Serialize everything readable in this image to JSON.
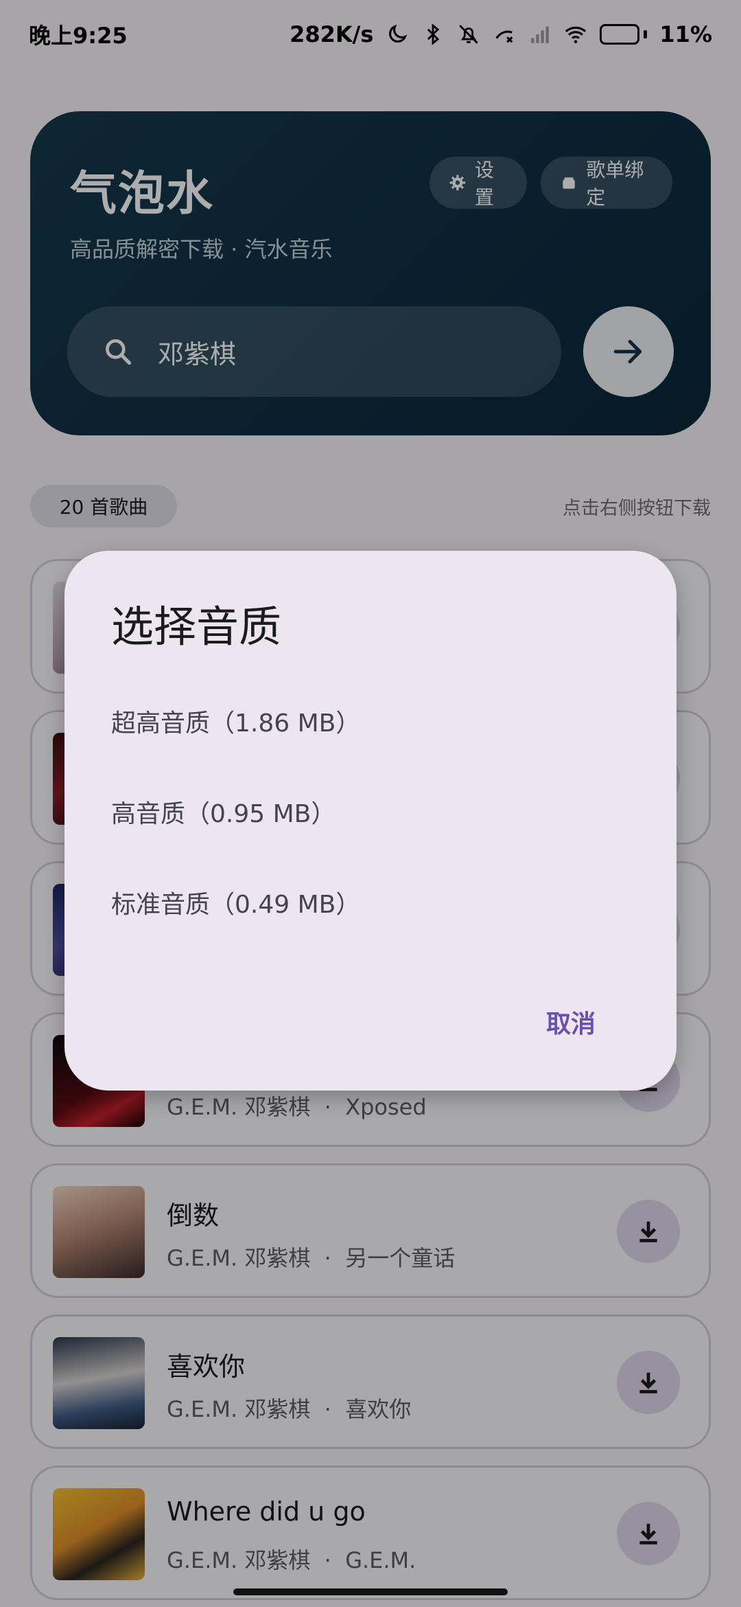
{
  "status_bar": {
    "time": "晚上9:25",
    "network_speed": "282K/s",
    "battery": "11%",
    "icons": [
      "moon-icon",
      "bluetooth-icon",
      "bell-off-icon",
      "phone-icon",
      "signal-icon",
      "wifi-icon",
      "battery-icon"
    ]
  },
  "header": {
    "title": "气泡水",
    "subtitle": "高品质解密下载 · 汽水音乐",
    "settings_label": "设置",
    "playlist_bind_label": "歌单绑定",
    "search_value": "邓紫棋"
  },
  "list_header": {
    "count": "20 首歌曲",
    "hint": "点击右侧按钮下载"
  },
  "songs": [
    {
      "title": "",
      "artist": "",
      "album": ""
    },
    {
      "title": "",
      "artist": "",
      "album": ""
    },
    {
      "title": "",
      "artist": "",
      "album": ""
    },
    {
      "title": "",
      "artist": "G.E.M. 邓紫棋",
      "album": "Xposed"
    },
    {
      "title": "倒数",
      "artist": "G.E.M. 邓紫棋",
      "album": "另一个童话"
    },
    {
      "title": "喜欢你",
      "artist": "G.E.M. 邓紫棋",
      "album": "喜欢你"
    },
    {
      "title": "Where did u go",
      "artist": "G.E.M. 邓紫棋",
      "album": "G.E.M."
    }
  ],
  "meta_separator": "·",
  "dialog": {
    "title": "选择音质",
    "options": [
      "超高音质（1.86 MB）",
      "高音质（0.95 MB）",
      "标准音质（0.49 MB）"
    ],
    "cancel_label": "取消"
  },
  "colors": {
    "header_bg": "#12334a",
    "accent": "#6a4fb0",
    "dialog_bg": "#ede6f1"
  }
}
